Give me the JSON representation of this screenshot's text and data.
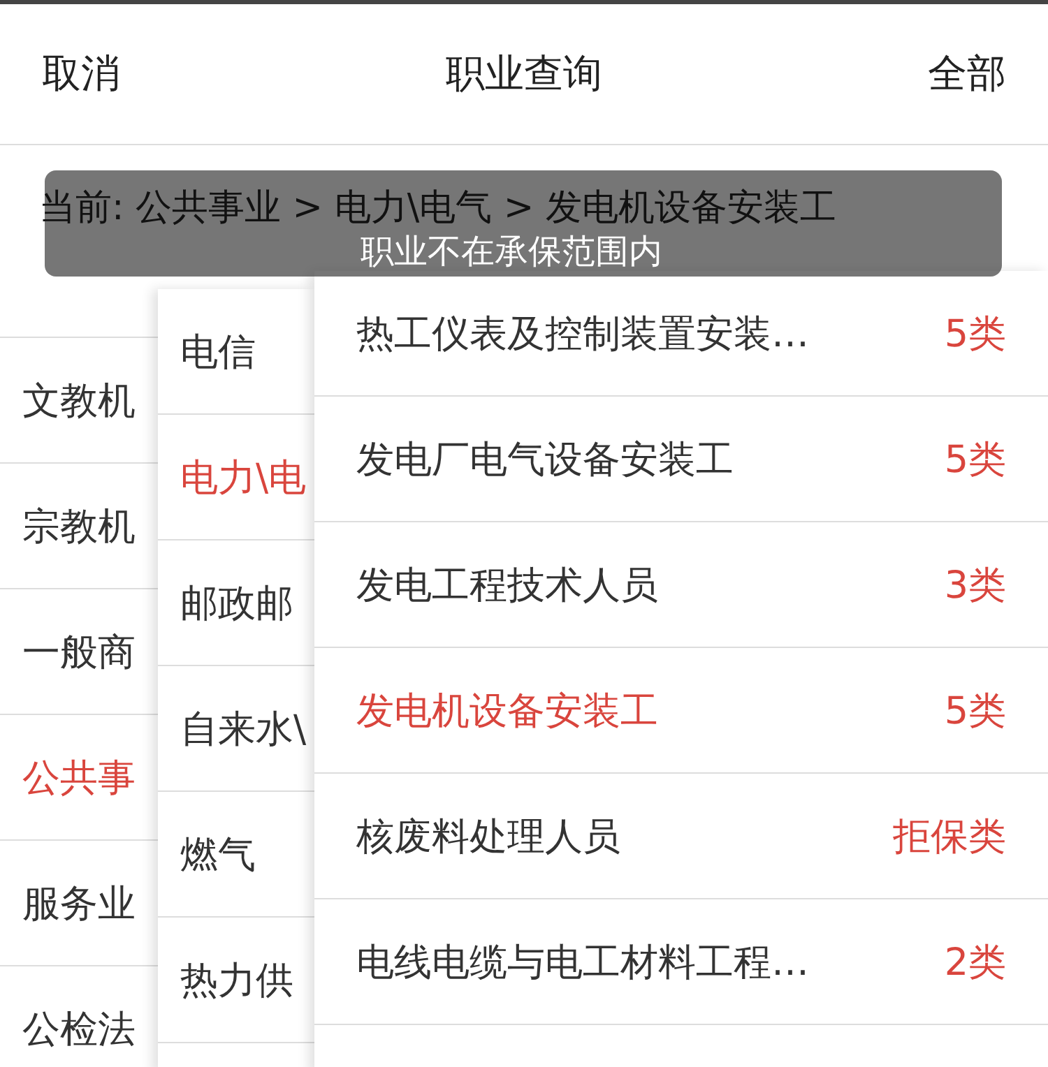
{
  "header": {
    "cancel": "取消",
    "title": "职业查询",
    "all": "全部"
  },
  "breadcrumb": "当前: 公共事业 > 电力\\电气 > 发电机设备安装工",
  "toast": "职业不在承保范围内",
  "categories": [
    {
      "label": "文教机",
      "selected": false
    },
    {
      "label": "宗教机",
      "selected": false
    },
    {
      "label": "一般商",
      "selected": false
    },
    {
      "label": "公共事",
      "selected": true
    },
    {
      "label": "服务业",
      "selected": false
    },
    {
      "label": "公检法",
      "selected": false
    }
  ],
  "subcategories": [
    {
      "label": "电信",
      "selected": false
    },
    {
      "label": "电力\\电",
      "selected": true
    },
    {
      "label": "邮政邮",
      "selected": false
    },
    {
      "label": "自来水\\",
      "selected": false
    },
    {
      "label": "燃气",
      "selected": false
    },
    {
      "label": "热力供",
      "selected": false
    }
  ],
  "occupations": [
    {
      "name": "热工仪表及控制装置安装…",
      "class": "5类",
      "selected": false
    },
    {
      "name": "发电厂电气设备安装工",
      "class": "5类",
      "selected": false
    },
    {
      "name": "发电工程技术人员",
      "class": "3类",
      "selected": false
    },
    {
      "name": "发电机设备安装工",
      "class": "5类",
      "selected": true
    },
    {
      "name": "核废料处理人员",
      "class": "拒保类",
      "selected": false
    },
    {
      "name": "电线电缆与电工材料工程…",
      "class": "2类",
      "selected": false
    }
  ]
}
